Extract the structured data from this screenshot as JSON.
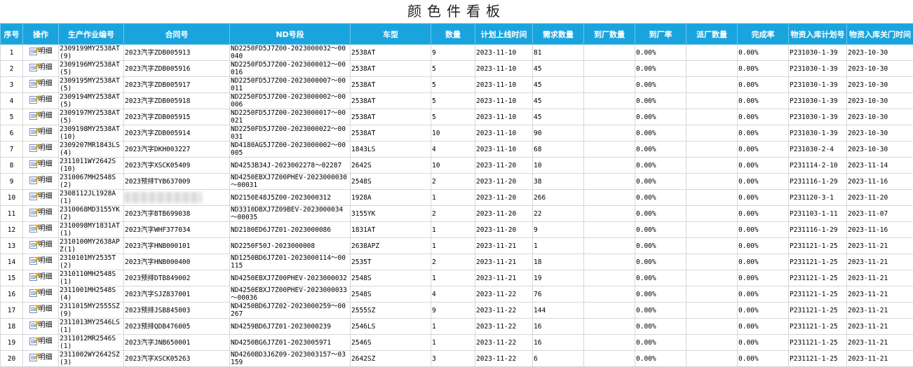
{
  "page": {
    "title": "颜色件看板"
  },
  "table": {
    "headers": [
      "序号",
      "操作",
      "生产作业编号",
      "合同号",
      "ND号段",
      "车型",
      "数量",
      "计划上线时间",
      "需求数量",
      "到厂数量",
      "到厂率",
      "派厂数量",
      "完成率",
      "物资入库计划号",
      "物资入库关门时间"
    ],
    "detail_label": "明细",
    "rows": [
      [
        "1",
        "",
        "2309199MY2538AT(9)",
        "2023汽字ZDB005913",
        "ND2250FD5J7Z00-2023000032～00040",
        "2538AT",
        "9",
        "2023-11-10",
        "81",
        "",
        "0.00%",
        "",
        "0.00%",
        "P231030-1-39",
        "2023-10-30"
      ],
      [
        "2",
        "",
        "2309196MY2538AT(5)",
        "2023汽字ZDB005916",
        "ND2250FD5J7Z00-2023000012～00016",
        "2538AT",
        "5",
        "2023-11-10",
        "45",
        "",
        "0.00%",
        "",
        "0.00%",
        "P231030-1-39",
        "2023-10-30"
      ],
      [
        "3",
        "",
        "2309195MY2538AT(5)",
        "2023汽字ZDB005917",
        "ND2250FD5J7Z00-2023000007～00011",
        "2538AT",
        "5",
        "2023-11-10",
        "45",
        "",
        "0.00%",
        "",
        "0.00%",
        "P231030-1-39",
        "2023-10-30"
      ],
      [
        "4",
        "",
        "2309194MY2538AT(5)",
        "2023汽字ZDB005918",
        "ND2250FD5J7Z00-2023000002～00006",
        "2538AT",
        "5",
        "2023-11-10",
        "45",
        "",
        "0.00%",
        "",
        "0.00%",
        "P231030-1-39",
        "2023-10-30"
      ],
      [
        "5",
        "",
        "2309197MY2538AT(5)",
        "2023汽字ZDB005915",
        "ND2250FD5J7Z00-2023000017～00021",
        "2538AT",
        "5",
        "2023-11-10",
        "45",
        "",
        "0.00%",
        "",
        "0.00%",
        "P231030-1-39",
        "2023-10-30"
      ],
      [
        "6",
        "",
        "2309198MY2538AT(10)",
        "2023汽字ZDB005914",
        "ND2250FD5J7Z00-2023000022～00031",
        "2538AT",
        "10",
        "2023-11-10",
        "90",
        "",
        "0.00%",
        "",
        "0.00%",
        "P231030-1-39",
        "2023-10-30"
      ],
      [
        "7",
        "",
        "2309207MR1843LS(4)",
        "2023汽字DKH003227",
        "ND4180AG5J7Z00-2023000002～00005",
        "1843LS",
        "4",
        "2023-11-10",
        "68",
        "",
        "0.00%",
        "",
        "0.00%",
        "P231030-2-4",
        "2023-10-30"
      ],
      [
        "8",
        "",
        "2311011WY2642S(10)",
        "2023汽字XSCK05409",
        "ND4253B34J-2023002278～02287",
        "2642S",
        "10",
        "2023-11-20",
        "10",
        "",
        "0.00%",
        "",
        "0.00%",
        "P231114-2-10",
        "2023-11-14"
      ],
      [
        "9",
        "",
        "2310067MH2548S(2)",
        "2023预排TYB637009",
        "ND4250EBXJ7Z00PHEV-2023000030～00031",
        "2548S",
        "2",
        "2023-11-20",
        "38",
        "",
        "0.00%",
        "",
        "0.00%",
        "P231116-1-29",
        "2023-11-16"
      ],
      [
        "10",
        "",
        "2308112JL1928A(1)",
        "",
        "ND2150E48J5Z00-2023000312",
        "1928A",
        "1",
        "2023-11-20",
        "266",
        "",
        "0.00%",
        "",
        "0.00%",
        "P231120-3-1",
        "2023-11-20"
      ],
      [
        "11",
        "",
        "2310068MD3155YK(2)",
        "2023汽字BTB699038",
        "ND3310DBXJ7Z09BEV-2023000034～00035",
        "3155YK",
        "2",
        "2023-11-20",
        "22",
        "",
        "0.00%",
        "",
        "0.00%",
        "P231103-1-11",
        "2023-11-07"
      ],
      [
        "12",
        "",
        "2310098MY1831AT(1)",
        "2023汽字WHF377034",
        "ND2180ED6J7Z01-2023000086",
        "1831AT",
        "1",
        "2023-11-20",
        "9",
        "",
        "0.00%",
        "",
        "0.00%",
        "P231116-1-29",
        "2023-11-16"
      ],
      [
        "13",
        "",
        "2310100MY2638APZ(1)",
        "2023汽字HNB000101",
        "ND2250F50J-2023000008",
        "2638APZ",
        "1",
        "2023-11-21",
        "1",
        "",
        "0.00%",
        "",
        "0.00%",
        "P231121-1-25",
        "2023-11-21"
      ],
      [
        "14",
        "",
        "2310101MY2535T(2)",
        "2023汽字HNB000400",
        "ND1250BD6J7Z01-2023000114～00115",
        "2535T",
        "2",
        "2023-11-21",
        "18",
        "",
        "0.00%",
        "",
        "0.00%",
        "P231121-1-25",
        "2023-11-21"
      ],
      [
        "15",
        "",
        "2310110MH2548S(1)",
        "2023预排DTB849002",
        "ND4250EBXJ7Z00PHEV-2023000032",
        "2548S",
        "1",
        "2023-11-21",
        "19",
        "",
        "0.00%",
        "",
        "0.00%",
        "P231121-1-25",
        "2023-11-21"
      ],
      [
        "16",
        "",
        "2311001MH2548S(4)",
        "2023汽字SJZ837001",
        "ND4250EBXJ7Z00PHEV-2023000033～00036",
        "2548S",
        "4",
        "2023-11-22",
        "76",
        "",
        "0.00%",
        "",
        "0.00%",
        "P231121-1-25",
        "2023-11-21"
      ],
      [
        "17",
        "",
        "2311015MY2555SZ(9)",
        "2023预排JSB845003",
        "ND4250BD6J7Z02-2023000259～00267",
        "2555SZ",
        "9",
        "2023-11-22",
        "144",
        "",
        "0.00%",
        "",
        "0.00%",
        "P231121-1-25",
        "2023-11-21"
      ],
      [
        "18",
        "",
        "2311013MY2546LS(1)",
        "2023预排QDB476005",
        "ND4259BD6J7Z01-2023000239",
        "2546LS",
        "1",
        "2023-11-22",
        "16",
        "",
        "0.00%",
        "",
        "0.00%",
        "P231121-1-25",
        "2023-11-21"
      ],
      [
        "19",
        "",
        "2311012MR2546S(1)",
        "2023汽字JNB650001",
        "ND4250BG6J7Z01-2023005971",
        "2546S",
        "1",
        "2023-11-22",
        "16",
        "",
        "0.00%",
        "",
        "0.00%",
        "P231121-1-25",
        "2023-11-21"
      ],
      [
        "20",
        "",
        "2311002WY2642SZ(3)",
        "2023汽字XSCK05263",
        "ND4260BD3J6Z09-2023003157～03159",
        "2642SZ",
        "3",
        "2023-11-22",
        "6",
        "",
        "0.00%",
        "",
        "0.00%",
        "P231121-1-25",
        "2023-11-21"
      ]
    ]
  }
}
